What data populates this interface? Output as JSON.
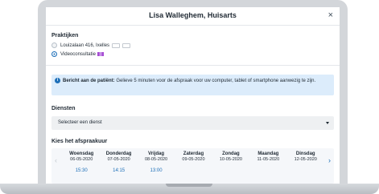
{
  "modal": {
    "title": "Lisa Walleghem, Huisarts",
    "close_symbol": "×"
  },
  "practices": {
    "label": "Praktijken",
    "options": [
      {
        "label": "Louizalaan 416, Ixelles",
        "selected": false
      },
      {
        "label": "Videoconsultatie",
        "selected": true
      }
    ]
  },
  "notice": {
    "icon": "info-icon",
    "title": "Bericht aan de patiënt:",
    "text": "Gelieve 5 minuten voor de afspraak voor uw computer, tablet of smartphone aanwezig te zijn."
  },
  "services": {
    "label": "Diensten",
    "select_value": "Selecteer een dienst"
  },
  "schedule": {
    "label": "Kies het afspraakuur",
    "prev_icon": "chevron-left-icon",
    "next_icon": "chevron-right-icon",
    "days": [
      {
        "name": "Woensdag",
        "date": "06-05-2020",
        "time": "15:30"
      },
      {
        "name": "Donderdag",
        "date": "07-05-2020",
        "time": "14:15"
      },
      {
        "name": "Vrijdag",
        "date": "08-05-2020",
        "time": "13:00"
      },
      {
        "name": "Zaterdag",
        "date": "09-05-2020",
        "time": ""
      },
      {
        "name": "Zondag",
        "date": "10-05-2020",
        "time": ""
      },
      {
        "name": "Maandag",
        "date": "11-05-2020",
        "time": ""
      },
      {
        "name": "Dinsdag",
        "date": "12-05-2020",
        "time": ""
      }
    ]
  },
  "colors": {
    "accent": "#1d6fb8",
    "notice_bg": "#dcecfb",
    "laptop": "#d3d6da"
  }
}
